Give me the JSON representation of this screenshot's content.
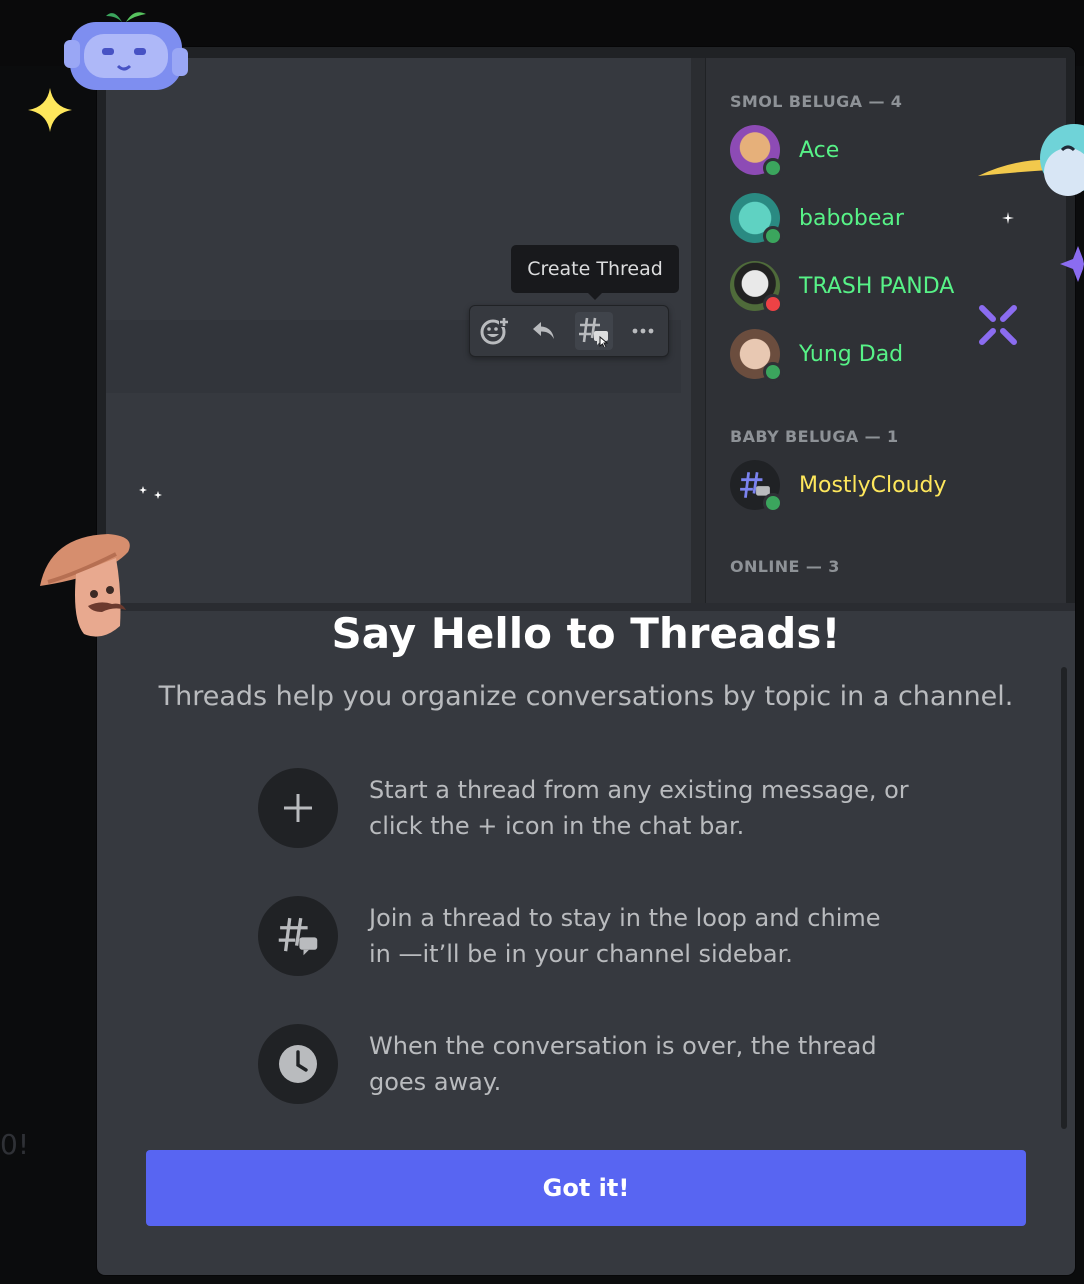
{
  "background": {
    "fragment_text": "0!"
  },
  "preview": {
    "tooltip": "Create Thread",
    "toolbar_icons": [
      "add-reaction-icon",
      "reply-icon",
      "create-thread-icon",
      "more-icon"
    ],
    "groups": [
      {
        "header": "SMOL BELUGA — 4"
      },
      {
        "header": "BABY BELUGA — 1"
      },
      {
        "header": "ONLINE — 3"
      }
    ],
    "members": [
      {
        "name": "Ace",
        "color": "#57f287",
        "status": "online"
      },
      {
        "name": "babobear",
        "color": "#57f287",
        "status": "online"
      },
      {
        "name": "TRASH PANDA",
        "color": "#57f287",
        "status": "dnd"
      },
      {
        "name": "Yung Dad",
        "color": "#57f287",
        "status": "online"
      },
      {
        "name": "MostlyCloudy",
        "color": "#fee75c",
        "status": "online"
      }
    ]
  },
  "modal": {
    "title": "Say Hello to Threads!",
    "subtitle": "Threads help you organize conversations by topic in a channel.",
    "features": [
      {
        "icon": "plus-icon",
        "text": "Start a thread from any existing message, or click the + icon in the chat bar."
      },
      {
        "icon": "thread-icon",
        "text": "Join a thread to stay in the loop and chime in —it’ll be in your channel sidebar."
      },
      {
        "icon": "clock-icon",
        "text": "When the conversation is over, the thread goes away."
      }
    ],
    "button_label": "Got it!",
    "accent_color": "#5865f2"
  }
}
